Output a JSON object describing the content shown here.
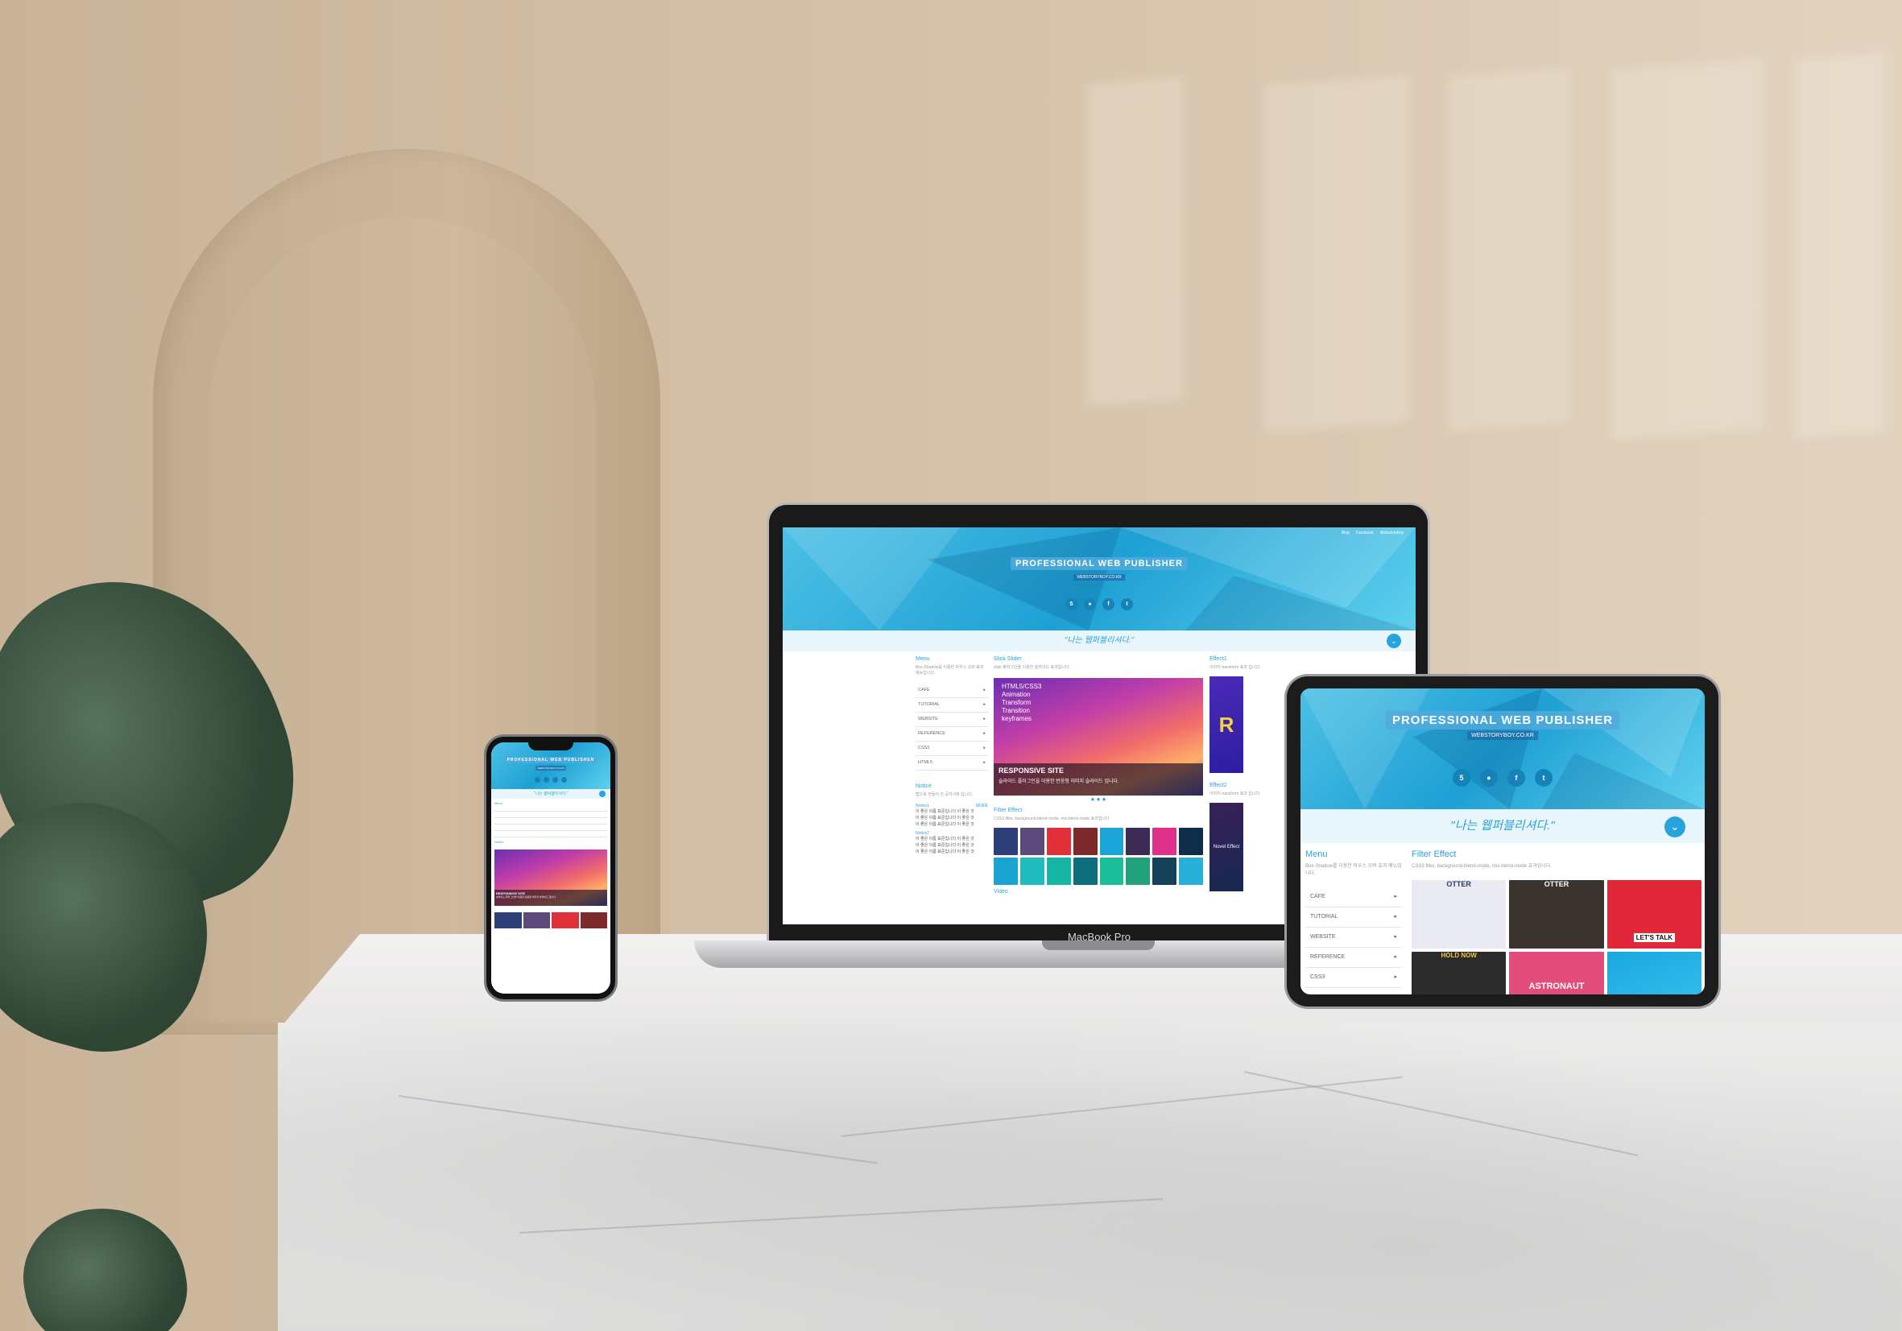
{
  "laptop": {
    "brand_label": "MacBook Pro",
    "site": {
      "top_nav": [
        "Blog",
        "Facebook",
        "Webstoryboy"
      ],
      "title": "PROFESSIONAL WEB PUBLISHER",
      "subtitle": "WEBSTORYBOY.CO.KR",
      "tagline": "\"나는 웹퍼블리셔다.\"",
      "menu": {
        "title": "Menu",
        "desc": "Box-Shadow를 이용한 마우스 오버 효과 메뉴입니다.",
        "items": [
          "CAFE",
          "TUTORIAL",
          "WEBSITE",
          "REFERENCE",
          "CSS3",
          "HTML5"
        ]
      },
      "notice": {
        "title": "Notice",
        "desc": "탭으로 만들어 진 공지사항 입니다.",
        "tabs": [
          "Notice1",
          "Notice2"
        ],
        "more": "MORE",
        "line": "이 좋은 이름 표준입니다 이 좋은 것"
      },
      "slider": {
        "title": "Slick Slider",
        "desc": "slick 플러그인을 이용한 슬라이드 효과입니다.",
        "list": [
          "HTML5/CSS3",
          "Animation",
          "Transform",
          "Transition",
          "keyframes"
        ],
        "caption_title": "RESPONSIVE SITE",
        "caption_text": "슬라이드 플러그인을 이용한 반응형 이미지 슬라이드 입니다."
      },
      "effect1": {
        "title": "Effect1",
        "desc": "이미지 transform 효과 입니다."
      },
      "effect2": {
        "title": "Effect2",
        "desc": "이미지 transform 효과 입니다.",
        "card_label": "Novel Effect"
      },
      "filter": {
        "title": "Filter Effect",
        "desc": "CSS3 filter, background-blend-mode, mix-blend-mode 효과입니다."
      },
      "video": {
        "title": "Video"
      }
    }
  },
  "tablet": {
    "site": {
      "title": "PROFESSIONAL WEB PUBLISHER",
      "subtitle": "WEBSTORYBOY.CO.KR",
      "tagline": "\"나는 웹퍼블리셔다.\"",
      "menu": {
        "title": "Menu",
        "desc": "Box-Shadow를 이용한 마우스 오버 효과 메뉴입니다.",
        "items": [
          "CAFE",
          "TUTORIAL",
          "WEBSITE",
          "REFERENCE",
          "CSS3"
        ]
      },
      "filter": {
        "title": "Filter Effect",
        "desc": "CSS3 filter, background-blend-mode, mix-blend-mode 효과입니다.",
        "cards": [
          "OTTER",
          "OTTER",
          "LET'S TALK",
          "HOLD NOW",
          "ASTRONAUT",
          ""
        ]
      }
    }
  },
  "phone": {
    "site": {
      "title": "PROFESSIONAL WEB PUBLISHER",
      "subtitle": "WEBSTORYBOY.CO.KR",
      "tagline": "\"나는 웹퍼블리셔다.\"",
      "menu_title": "Menu",
      "notice_title": "Notice",
      "caption_title": "RESPONSIVE SITE",
      "caption_text": "슬라이드 플러그인을 이용한 반응형 이미지 슬라이드 입니다."
    }
  },
  "icons": [
    "html5-icon",
    "github-icon",
    "facebook-icon",
    "twitter-icon",
    "chevron-down-icon",
    "arrow-right-icon"
  ],
  "colors": {
    "accent": "#29a3db",
    "hero": "#1ea0d4",
    "tagline_bg": "#e9f6fc",
    "wall": "#d4c0a6",
    "marble": "#e8e7e6"
  }
}
